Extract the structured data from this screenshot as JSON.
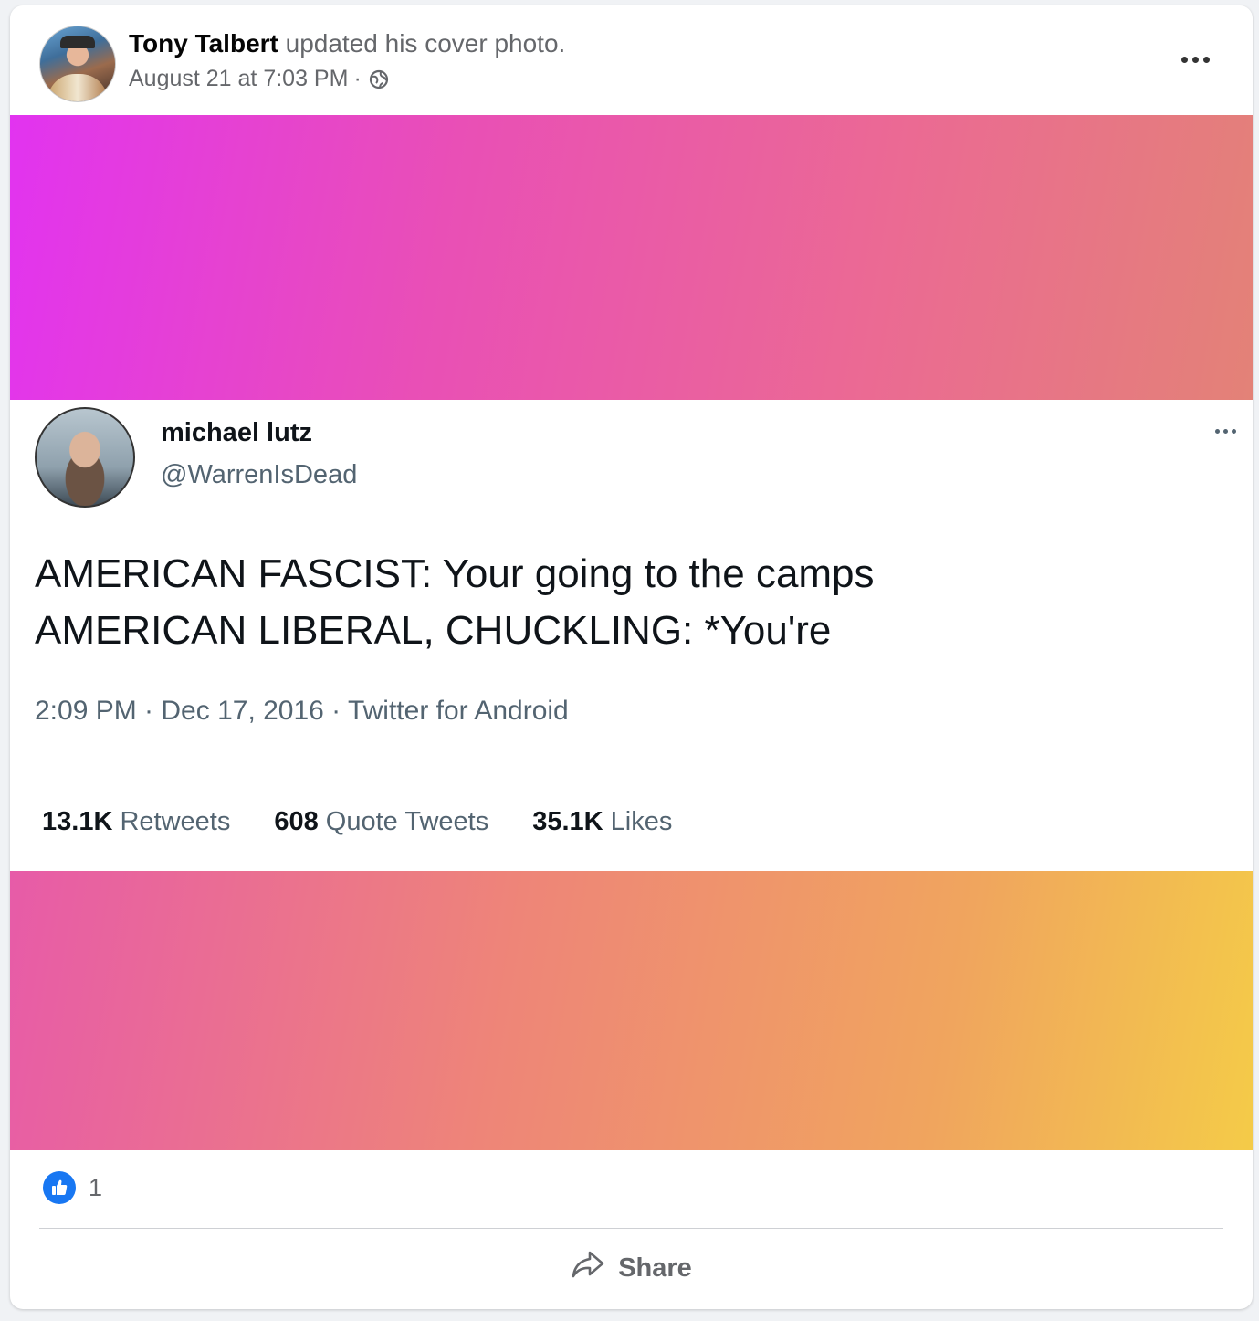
{
  "post": {
    "author": "Tony Talbert",
    "action": "updated his cover photo.",
    "timestamp": "August 21 at 7:03 PM",
    "separator": "·",
    "privacy_icon": "globe-icon",
    "more_icon": "more-horizontal-icon"
  },
  "tweet": {
    "name": "michael lutz",
    "handle": "@WarrenIsDead",
    "lines": [
      "AMERICAN FASCIST: Your going to the camps",
      "AMERICAN LIBERAL, CHUCKLING: *You're"
    ],
    "meta": "2:09 PM · Dec 17, 2016 · Twitter for Android",
    "stats": {
      "retweets_count": "13.1K",
      "retweets_label": "Retweets",
      "quotes_count": "608",
      "quotes_label": "Quote Tweets",
      "likes_count": "35.1K",
      "likes_label": "Likes"
    }
  },
  "footer": {
    "reaction_icon": "like-icon",
    "reaction_count": "1",
    "share_label": "Share",
    "share_icon": "share-arrow-icon"
  },
  "colors": {
    "facebook_blue": "#1877f2",
    "secondary_text": "#65676b",
    "top_gradient": [
      "#e233f0",
      "#e38277"
    ],
    "bottom_gradient": [
      "#e75ba8",
      "#f4cb48"
    ]
  }
}
